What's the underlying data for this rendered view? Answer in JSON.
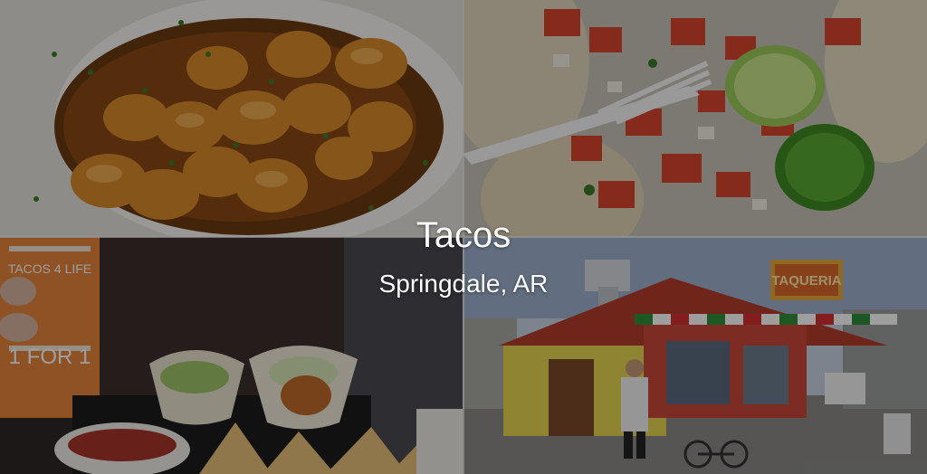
{
  "hero": {
    "title": "Tacos",
    "subtitle": "Springdale, AR"
  },
  "tiles": [
    {
      "name": "shrimp-dish-photo",
      "description_icon": "shrimp-image"
    },
    {
      "name": "tacos-with-pico-photo",
      "description_icon": "taco-image"
    },
    {
      "name": "tacos-and-drink-photo",
      "description_icon": "taco-plate-image"
    },
    {
      "name": "taqueria-storefront-photo",
      "description_icon": "storefront-image"
    }
  ],
  "image_text": {
    "cup_text_1": "TACOS 4 LIFE",
    "cup_text_2": "1 FOR 1",
    "sign_text": "TAQUERIA"
  },
  "colors": {
    "overlay": "rgba(0,0,0,0.38)",
    "caption": "#ffffff",
    "divider": "#f4f4f4"
  }
}
